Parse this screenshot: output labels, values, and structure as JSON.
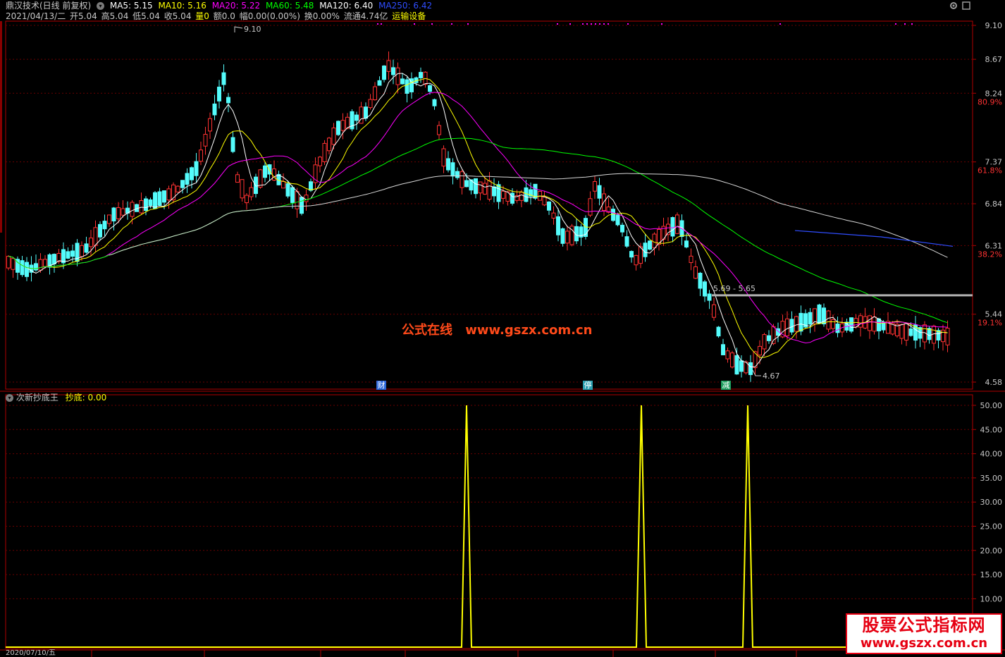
{
  "header": {
    "app_title": "鼎汉技术(日线 前复权)",
    "ma": [
      {
        "label": "MA5: 5.15",
        "color": "#ffffff"
      },
      {
        "label": "MA10: 5.16",
        "color": "#ffff00"
      },
      {
        "label": "MA20: 5.22",
        "color": "#ff00ff"
      },
      {
        "label": "MA60: 5.48",
        "color": "#00ff00"
      },
      {
        "label": "MA120: 6.40",
        "color": "#ffffff"
      },
      {
        "label": "MA250: 6.42",
        "color": "#2f4dff"
      }
    ],
    "quote": {
      "date": "2021/04/13/二",
      "open": "开5.04",
      "high": "高5.04",
      "low": "低5.04",
      "close": "收5.04",
      "volume": "量0",
      "amount": "额0.0",
      "change": "幅0.00(0.00%)",
      "turnover": "换0.00%",
      "float": "流通4.74亿",
      "concept": "运输设备"
    }
  },
  "price_axis": {
    "labels": [
      "9.10",
      "8.67",
      "8.24",
      "80.9%",
      "7.37",
      "61.8%",
      "6.84",
      "6.31",
      "38.2%",
      "5.44",
      "19.1%",
      "4.58"
    ]
  },
  "annotations": {
    "high": "9.10",
    "low": "4.67",
    "range": "5.69 - 5.65",
    "markers": [
      "财",
      "停",
      "减"
    ]
  },
  "indicator": {
    "name": "次新抄底王",
    "value": "抄底: 0.00",
    "axis_labels": [
      "50.00",
      "45.00",
      "40.00",
      "35.00",
      "30.00",
      "25.00",
      "20.00",
      "15.00",
      "10.00"
    ],
    "spikes": [
      50,
      50,
      50
    ]
  },
  "footer": {
    "date": "2020/07/10/五"
  },
  "watermarks": {
    "center_cn": "公式在线",
    "center_url": "www.gszx.com.cn",
    "box_title": "股票公式指标网",
    "box_url": "www.gszx.com.cn"
  },
  "colors": {
    "up": "#ff3232",
    "down": "#54fcfc",
    "ma5": "#ffffff",
    "ma10": "#ffff00",
    "ma20": "#ff00ff",
    "ma60": "#00ff00",
    "ma120": "#ffffff",
    "ma250": "#2f4dff",
    "indicator_line": "#ffff00",
    "axis": "#b00000"
  },
  "chart_data": [
    {
      "type": "candlestick",
      "title": "鼎汉技术(日线 前复权)",
      "y_ticks": [
        4.58,
        5.44,
        6.31,
        6.84,
        7.37,
        8.24,
        8.67,
        9.1
      ],
      "ylim": [
        4.58,
        9.1
      ],
      "annotated_high": 9.1,
      "annotated_low": 4.67,
      "reference_range": [
        5.69,
        5.65
      ],
      "moving_averages": [
        "MA5",
        "MA10",
        "MA20",
        "MA60",
        "MA120",
        "MA250"
      ],
      "grid": true
    },
    {
      "type": "line",
      "title": "次新抄底王",
      "series": [
        {
          "name": "抄底",
          "values": [
            50,
            50,
            50
          ]
        }
      ],
      "ylim": [
        0,
        50
      ],
      "y_ticks": [
        10,
        15,
        20,
        25,
        30,
        35,
        40,
        45,
        50
      ],
      "grid": true
    }
  ]
}
